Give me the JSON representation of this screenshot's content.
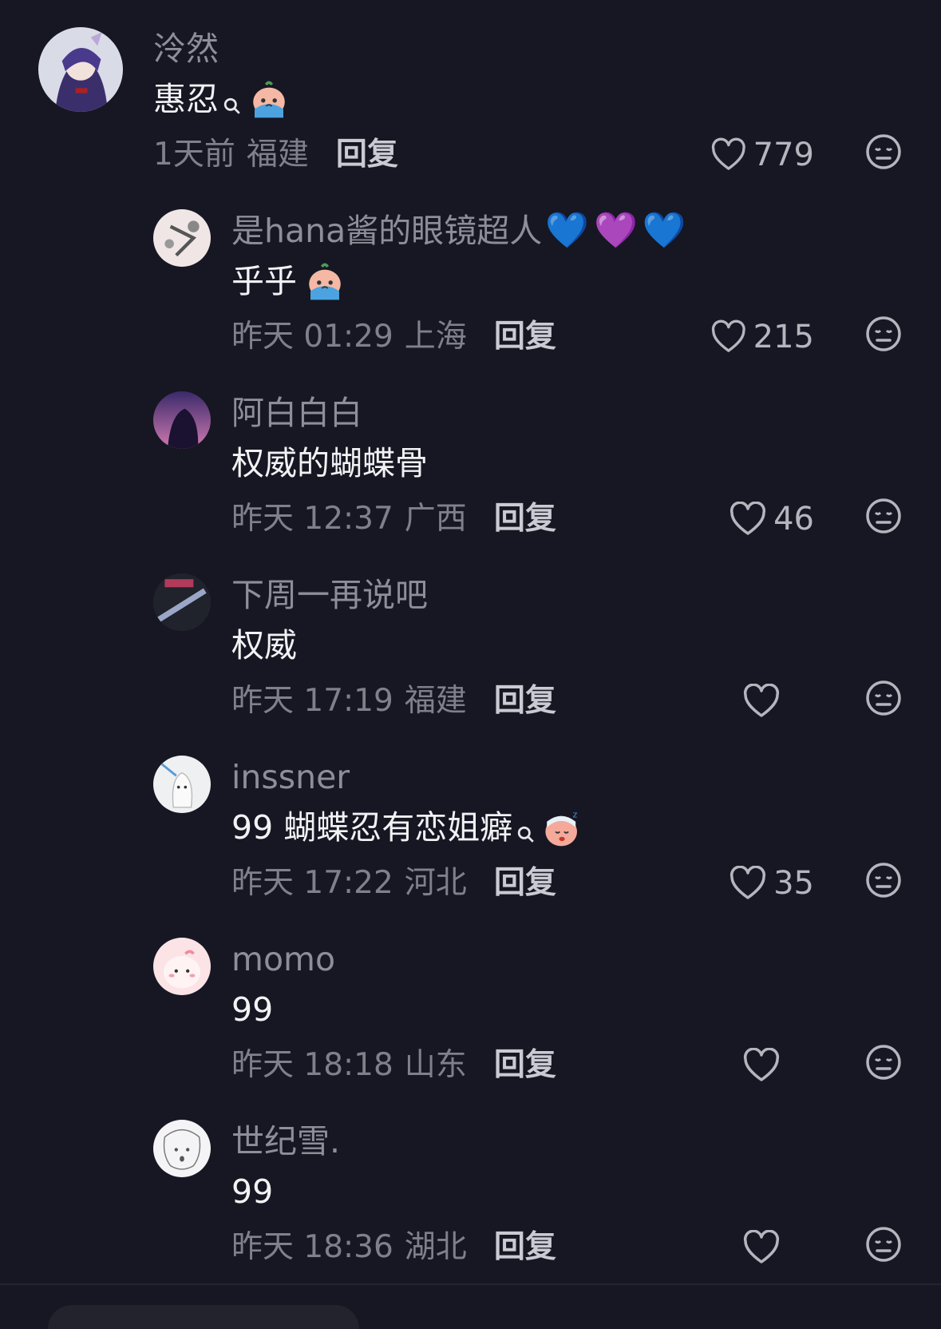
{
  "comments": [
    {
      "name": "泠然",
      "text": "惠忍",
      "time": "1天前",
      "location": "福建",
      "reply_label": "回复",
      "likes": "779"
    },
    {
      "name": "是hana酱的眼镜超人",
      "name_hearts": [
        "💙",
        "💜",
        "💙"
      ],
      "text": "乎乎",
      "time": "昨天 01:29",
      "location": "上海",
      "reply_label": "回复",
      "likes": "215"
    },
    {
      "name": "阿白白白",
      "text": "权威的蝴蝶骨",
      "time": "昨天 12:37",
      "location": "广西",
      "reply_label": "回复",
      "likes": "46"
    },
    {
      "name": "下周一再说吧",
      "text": "权威",
      "time": "昨天 17:19",
      "location": "福建",
      "reply_label": "回复",
      "likes": ""
    },
    {
      "name": "inssner",
      "text": "99 蝴蝶忍有恋姐癖",
      "time": "昨天 17:22",
      "location": "河北",
      "reply_label": "回复",
      "likes": "35"
    },
    {
      "name": "momo",
      "text": "99",
      "time": "昨天 18:18",
      "location": "山东",
      "reply_label": "回复",
      "likes": ""
    },
    {
      "name": "世纪雪.",
      "text": "99",
      "time": "昨天 18:36",
      "location": "湖北",
      "reply_label": "回复",
      "likes": ""
    }
  ],
  "icons": {
    "like": "heart-outline-icon",
    "dislike": "neutral-face-icon",
    "search_superscript": "search-icon",
    "crying_emoji": "crying-face-emoji",
    "sleeping_emoji": "sleepy-face-emoji"
  },
  "colors": {
    "background": "#161722",
    "username": "#8d8e98",
    "text": "#f2f2f5",
    "meta": "#7f808a"
  }
}
